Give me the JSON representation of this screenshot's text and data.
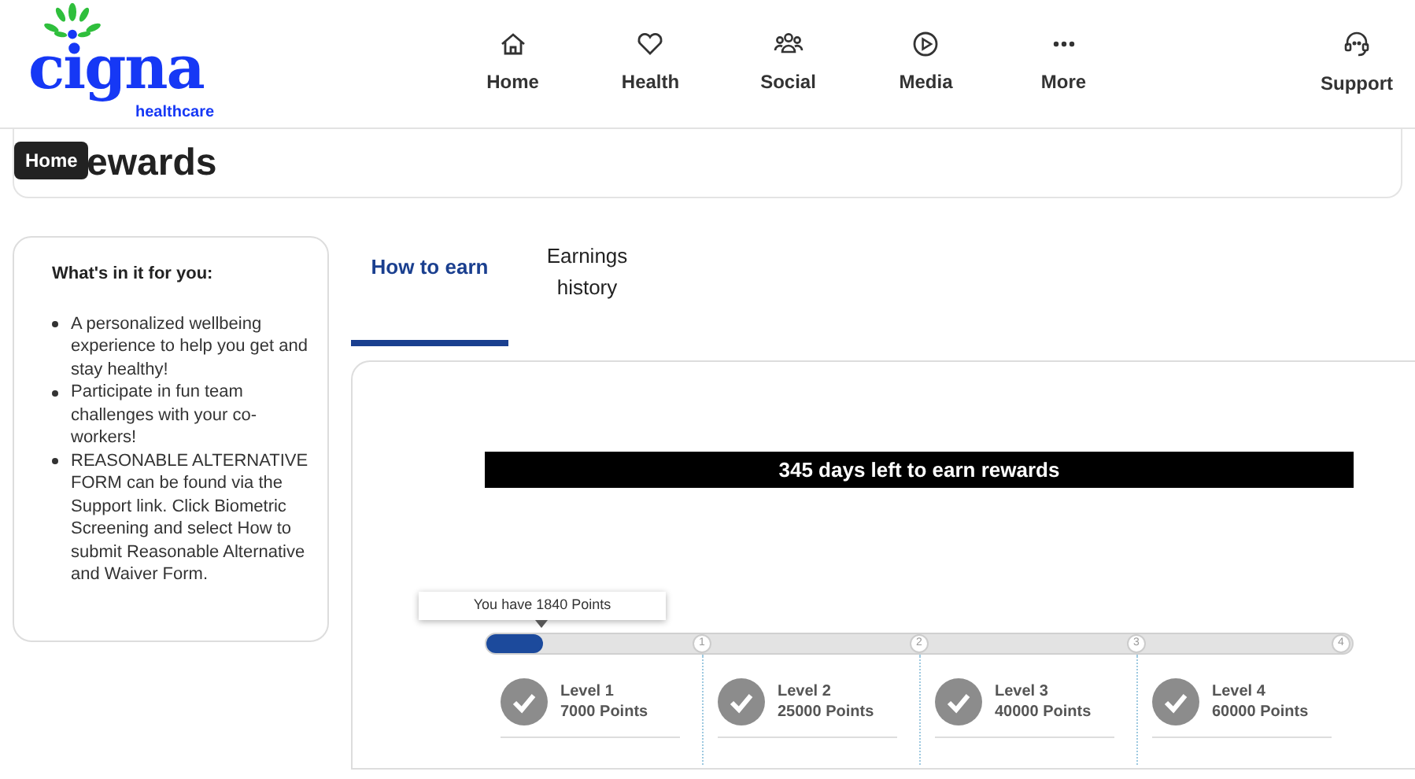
{
  "header": {
    "logo": {
      "wordmark": "cigna",
      "tagline": "healthcare"
    },
    "nav": [
      {
        "label": "Home"
      },
      {
        "label": "Health"
      },
      {
        "label": "Social"
      },
      {
        "label": "Media"
      },
      {
        "label": "More"
      }
    ],
    "support": {
      "label": "Support"
    }
  },
  "page_title": "ewards",
  "tooltip": "Home",
  "info_card": {
    "heading": "What's in it for you:",
    "items": [
      "A personalized wellbeing experience to help you get and stay healthy!",
      "Participate in fun team challenges with your co-workers!",
      "REASONABLE ALTERNATIVE FORM can be found via the Support link. Click Biometric Screening and select How to submit Reasonable Alternative and Waiver Form."
    ]
  },
  "tabs": [
    {
      "label": "How to earn",
      "selected": true
    },
    {
      "label": "Earnings history",
      "selected": false
    }
  ],
  "banner": "345 days left to earn rewards",
  "progress": {
    "callout": "You have 1840 Points",
    "level": 0.066,
    "markers": [
      "1",
      "2",
      "3",
      "4"
    ]
  },
  "levels": [
    {
      "name": "Level 1",
      "points": "7000 Points",
      "done": true
    },
    {
      "name": "Level 2",
      "points": "25000 Points",
      "done": true
    },
    {
      "name": "Level 3",
      "points": "40000 Points",
      "done": true
    },
    {
      "name": "Level 4",
      "points": "60000 Points",
      "done": true
    }
  ]
}
